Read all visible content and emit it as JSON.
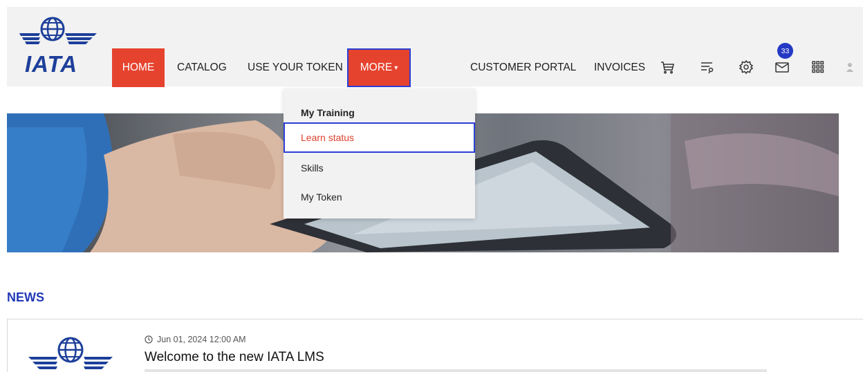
{
  "brand": {
    "logo_text": "IATA",
    "color": "#1d3f9a"
  },
  "nav": {
    "home": "HOME",
    "catalog": "CATALOG",
    "use_token": "USE YOUR TOKEN",
    "more": "MORE",
    "customer_portal": "CUSTOMER PORTAL",
    "invoices": "INVOICES"
  },
  "header_icons": [
    "cart-icon",
    "playlist-search-icon",
    "gear-icon",
    "mail-icon",
    "apps-grid-icon",
    "avatar-icon"
  ],
  "mail_badge": "33",
  "more_menu": {
    "items": [
      {
        "label": "My Training"
      },
      {
        "label": "Learn status"
      },
      {
        "label": "Skills"
      },
      {
        "label": "My Token"
      }
    ]
  },
  "news": {
    "section_title": "NEWS",
    "items": [
      {
        "date": "Jun 01, 2024 12:00 AM",
        "title": "Welcome to the new IATA LMS"
      }
    ]
  },
  "colors": {
    "accent_red": "#e6432f",
    "highlight_blue": "#2b3fd6",
    "news_blue": "#2239b8"
  }
}
